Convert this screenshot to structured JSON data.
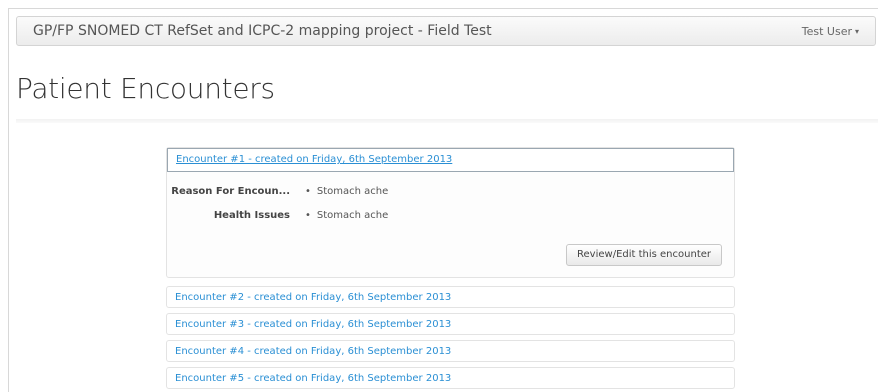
{
  "navbar": {
    "brand": "GP/FP SNOMED CT RefSet and ICPC-2 mapping project - Field Test",
    "user": "Test User",
    "user_caret": "▾"
  },
  "page": {
    "title": "Patient Encounters"
  },
  "encounters": [
    {
      "title": "Encounter #1 - created on Friday, 6th September 2013",
      "expanded": true,
      "fields": [
        {
          "label": "Reason For Encoun...",
          "values": [
            "Stomach ache"
          ]
        },
        {
          "label": "Health Issues",
          "values": [
            "Stomach ache"
          ]
        }
      ],
      "action_label": "Review/Edit this encounter"
    },
    {
      "title": "Encounter #2 - created on Friday, 6th September 2013",
      "expanded": false
    },
    {
      "title": "Encounter #3 - created on Friday, 6th September 2013",
      "expanded": false
    },
    {
      "title": "Encounter #4 - created on Friday, 6th September 2013",
      "expanded": false
    },
    {
      "title": "Encounter #5 - created on Friday, 6th September 2013",
      "expanded": false
    }
  ],
  "colors": {
    "link": "#2a8fd4",
    "navbar_bg": "#f2f2f2"
  }
}
